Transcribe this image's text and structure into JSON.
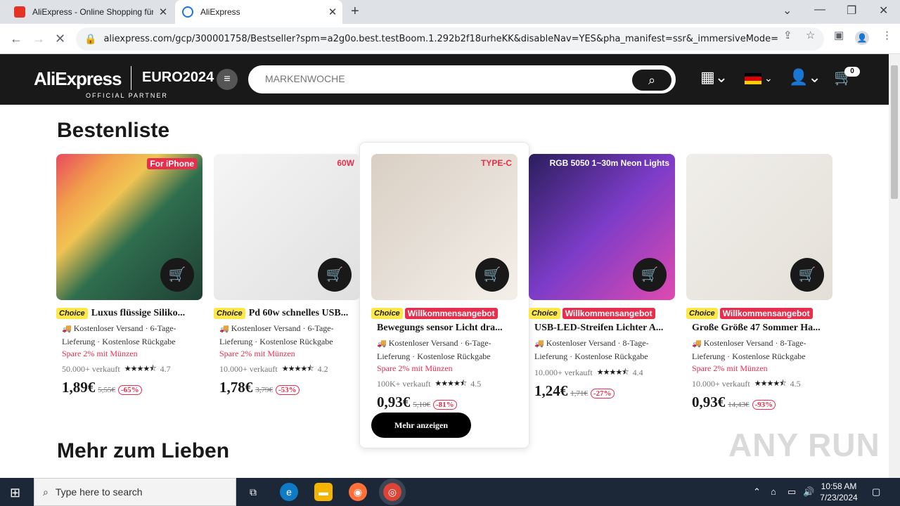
{
  "browser": {
    "tabs": [
      {
        "title": "AliExpress - Online Shopping für",
        "active": false
      },
      {
        "title": "AliExpress",
        "active": true
      }
    ],
    "url": "aliexpress.com/gcp/300001758/Bestseller?spm=a2g0o.best.testBoom.1.292b2f18urheKK&disableNav=YES&pha_manifest=ssr&_immersiveMode=true&pr..."
  },
  "header": {
    "logo": "AliExpress",
    "euro": "EURO2024",
    "partner": "OFFICIAL PARTNER",
    "search_placeholder": "MARKENWOCHE",
    "cart_count": "0"
  },
  "section_title": "Bestenliste",
  "section2_title": "Mehr zum Lieben",
  "choice_label": "Choice",
  "welcome_label": "Willkommensangebot",
  "more_button": "Mehr anzeigen",
  "products": [
    {
      "title": "Luxus flüssige Siliko...",
      "shipping": "Kostenloser Versand · 6-Tage-Lieferung · Kostenlose Rückgabe",
      "spare": "Spare 2% mit Münzen",
      "sold": "50.000+ verkauft",
      "rating": "4.7",
      "stars": 4.7,
      "price": "1,89€",
      "old_price": "5,55€",
      "discount": "-65%",
      "welcome": false,
      "image_text": "For iPhone"
    },
    {
      "title": "Pd 60w schnelles USB...",
      "shipping": "Kostenloser Versand · 6-Tage-Lieferung · Kostenlose Rückgabe",
      "spare": "Spare 2% mit Münzen",
      "sold": "10.000+ verkauft",
      "rating": "4.2",
      "stars": 4.2,
      "price": "1,78€",
      "old_price": "3,79€",
      "discount": "-53%",
      "welcome": false,
      "image_text": "60W"
    },
    {
      "title": "Bewegungs sensor Licht dra...",
      "shipping": "Kostenloser Versand · 6-Tage-Lieferung · Kostenlose Rückgabe",
      "spare": "Spare 2% mit Münzen",
      "sold": "100K+ verkauft",
      "rating": "4.5",
      "stars": 4.5,
      "price": "0,93€",
      "old_price": "5,10€",
      "discount": "-81%",
      "welcome": true,
      "image_text": "TYPE-C"
    },
    {
      "title": "USB-LED-Streifen Lichter A...",
      "shipping": "Kostenloser Versand · 8-Tage-Lieferung · Kostenlose Rückgabe",
      "spare": "",
      "sold": "10.000+ verkauft",
      "rating": "4.4",
      "stars": 4.4,
      "price": "1,24€",
      "old_price": "1,71€",
      "discount": "-27%",
      "welcome": true,
      "image_text": "RGB 5050 1~30m Neon Lights"
    },
    {
      "title": "Große Größe 47 Sommer Ha...",
      "shipping": "Kostenloser Versand · 8-Tage-Lieferung · Kostenlose Rückgabe",
      "spare": "Spare 2% mit Münzen",
      "sold": "10.000+ verkauft",
      "rating": "4.5",
      "stars": 4.5,
      "price": "0,93€",
      "old_price": "14,43€",
      "discount": "-93%",
      "welcome": true,
      "image_text": ""
    }
  ],
  "watermark": "ANY RUN",
  "taskbar": {
    "search_placeholder": "Type here to search",
    "time": "10:58 AM",
    "date": "7/23/2024"
  },
  "colors": {
    "accent": "#e62e4d",
    "choice": "#fde847",
    "header": "#191919"
  }
}
